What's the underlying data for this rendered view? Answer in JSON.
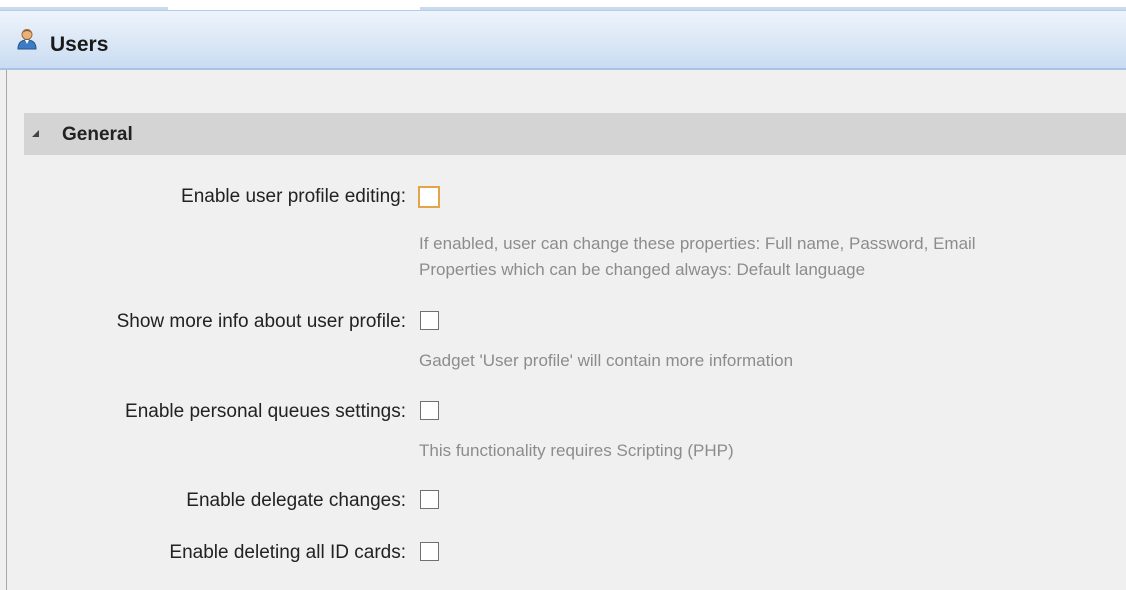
{
  "header": {
    "title": "Users",
    "icon": "user-icon"
  },
  "section": {
    "title": "General",
    "expanded": true
  },
  "settings": [
    {
      "label": "Enable user profile editing:",
      "checked": false,
      "hints": [
        "If enabled, user can change these properties: Full name, Password, Email",
        "Properties which can be changed always: Default language"
      ]
    },
    {
      "label": "Show more info about user profile:",
      "checked": false,
      "hints": [
        "Gadget 'User profile' will contain more information"
      ]
    },
    {
      "label": "Enable personal queues settings:",
      "checked": false,
      "hints": [
        "This functionality requires Scripting (PHP)"
      ]
    },
    {
      "label": "Enable delegate changes:",
      "checked": false,
      "hints": []
    },
    {
      "label": "Enable deleting all ID cards:",
      "checked": false,
      "hints": []
    }
  ],
  "colors": {
    "header_blue": "#c9dcf2",
    "section_gray": "#d4d4d4",
    "focus_orange": "#e3a44a"
  }
}
